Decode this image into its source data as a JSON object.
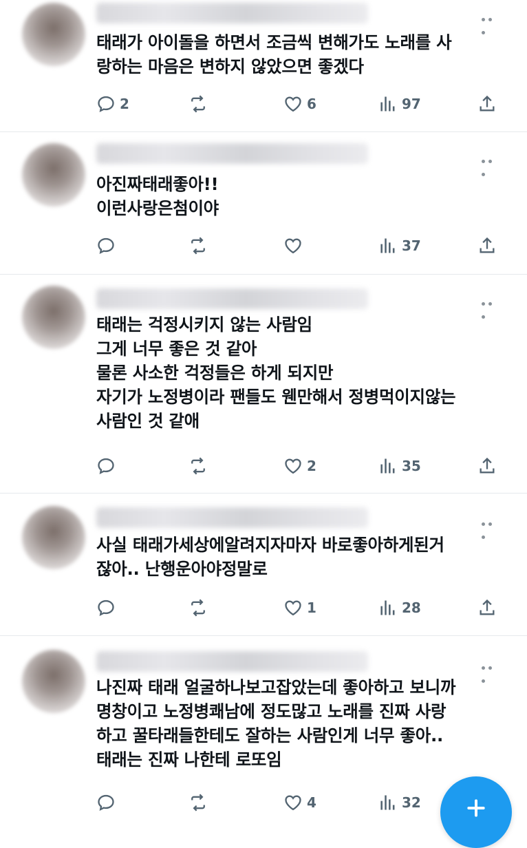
{
  "tweets": [
    {
      "text": "태래가 아이돌을 하면서 조금씩 변해가도 노래를 사\n랑하는 마음은 변하지 않았으면 좋겠다",
      "replies": "2",
      "retweets": "",
      "likes": "6",
      "views": "97"
    },
    {
      "text": "아진짜태래좋아!!\n이런사랑은첨이야",
      "replies": "",
      "retweets": "",
      "likes": "",
      "views": "37"
    },
    {
      "text": "태래는 걱정시키지 않는 사람임\n그게 너무 좋은 것 같아\n물론 사소한 걱정들은 하게 되지만\n자기가 노정병이라 팬들도 웬만해서 정병먹이지않는\n사람인 것 같애",
      "replies": "",
      "retweets": "",
      "likes": "2",
      "views": "35"
    },
    {
      "text": "사실 태래가세상에알려지자마자 바로좋아하게된거\n잖아.. 난행운아야정말로",
      "replies": "",
      "retweets": "",
      "likes": "1",
      "views": "28"
    },
    {
      "text": "나진짜 태래 얼굴하나보고잡았는데 좋아하고 보니까\n명창이고 노정병쾌남에 정도많고 노래를 진짜 사랑\n하고 꿀타래들한테도 잘하는 사람인게 너무 좋아..\n태래는 진짜 나한테 로또임",
      "replies": "",
      "retweets": "",
      "likes": "4",
      "views": "32"
    }
  ],
  "icons": {
    "reply": "reply-icon",
    "retweet": "retweet-icon",
    "like": "heart-icon",
    "views": "views-icon",
    "share": "share-icon",
    "more": "more-icon",
    "compose": "compose-plus-icon"
  },
  "colors": {
    "accent": "#1d9bf0",
    "action_gray": "#536471",
    "text": "#0f1419",
    "divider": "#e6e9ec"
  }
}
